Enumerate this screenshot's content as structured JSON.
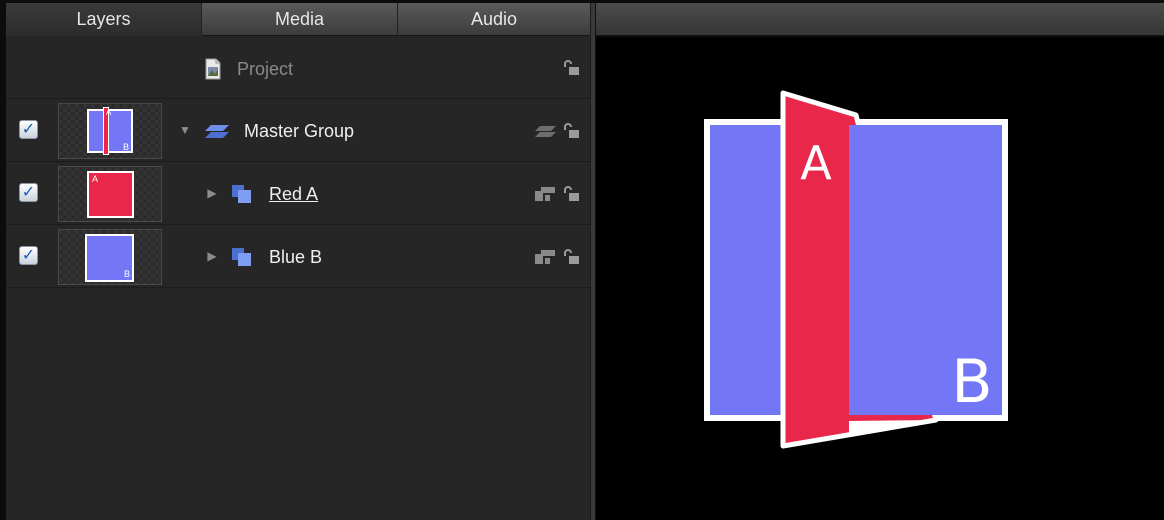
{
  "tabs": [
    {
      "label": "Layers",
      "active": true
    },
    {
      "label": "Media",
      "active": false
    },
    {
      "label": "Audio",
      "active": false
    }
  ],
  "project": {
    "label": "Project",
    "icon": "project-document-icon"
  },
  "layers": [
    {
      "name": "Master Group",
      "checked": true,
      "expanded": true,
      "type_icon": "group-icon",
      "thumb_letters": [
        "A",
        "B"
      ]
    },
    {
      "name": "Red A",
      "checked": true,
      "expanded": false,
      "type_icon": "layer-stack-icon",
      "thumb_letters": [
        "A"
      ],
      "color": "#e8274a"
    },
    {
      "name": "Blue B",
      "checked": true,
      "expanded": false,
      "type_icon": "layer-stack-icon",
      "thumb_letters": [
        "B"
      ],
      "color": "#7377f5"
    }
  ],
  "canvas": {
    "blue_letter": "B",
    "red_letter": "A",
    "blue_color": "#7377f5",
    "red_color": "#e8274a",
    "background": "#000000"
  },
  "check_mark": "✓"
}
